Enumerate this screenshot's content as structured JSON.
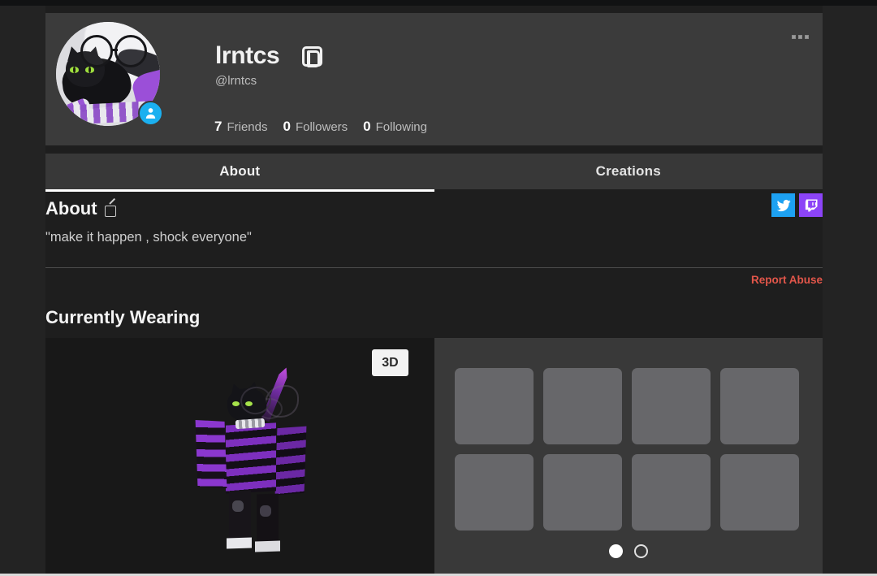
{
  "profile": {
    "display_name": "lrntcs",
    "username": "@lrntcs",
    "premium_badge": "premium-icon",
    "presence": "website-presence-icon",
    "more_menu": "ellipsis-icon",
    "stats": [
      {
        "count": "7",
        "label": "Friends"
      },
      {
        "count": "0",
        "label": "Followers"
      },
      {
        "count": "0",
        "label": "Following"
      }
    ]
  },
  "tabs": [
    {
      "label": "About",
      "active": true
    },
    {
      "label": "Creations",
      "active": false
    }
  ],
  "about": {
    "title": "About",
    "edit_icon": "edit-pencil-icon",
    "bio": "\"make it happen , shock everyone\"",
    "report_abuse": "Report Abuse"
  },
  "social": [
    {
      "name": "twitter",
      "icon": "twitter-icon",
      "color": "#1da1f2"
    },
    {
      "name": "twitch",
      "icon": "twitch-icon",
      "color": "#8c44f7"
    }
  ],
  "currently_wearing": {
    "title": "Currently Wearing",
    "view_3d_label": "3D",
    "items": [
      {
        "label": ""
      },
      {
        "label": ""
      },
      {
        "label": ""
      },
      {
        "label": ""
      },
      {
        "label": ""
      },
      {
        "label": ""
      },
      {
        "label": ""
      },
      {
        "label": ""
      }
    ],
    "pagination": [
      {
        "state": "filled"
      },
      {
        "state": "hollow"
      }
    ]
  },
  "colors": {
    "page_background": "#1e1e1e",
    "card_background": "#3b3b3b",
    "tab_background": "#383838",
    "items_panel": "#393939",
    "item_tile": "#67676a",
    "report_red": "#e2564a",
    "accent_white": "#ffffff"
  }
}
